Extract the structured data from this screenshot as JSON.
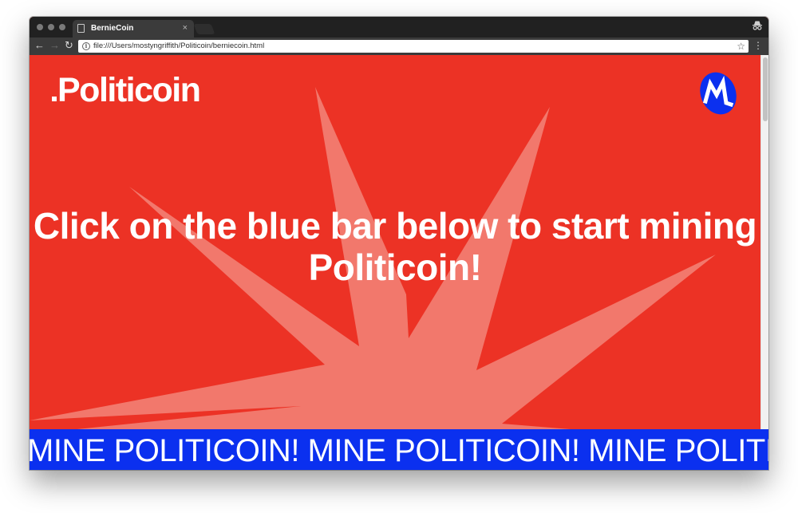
{
  "browser": {
    "tab_title": "BernieCoin",
    "tab_close": "×",
    "url": "file:///Users/mostyngriffith/Politicoin/berniecoin.html",
    "icons": {
      "back": "arrow-left",
      "forward": "arrow-right",
      "reload": "reload",
      "info": "info-circle",
      "bookmark": "star",
      "menu": "vertical-dots",
      "incognito": "incognito"
    }
  },
  "page": {
    "logo_text": "Politicoin",
    "headline": "Click on the blue bar below to start mining Politicoin!",
    "mine_bar_text": "MINE POLITICOIN! MINE POLITICOIN! MINE POLITICOIN!",
    "colors": {
      "background": "#ec3225",
      "burst": "#f2786c",
      "mine_bar": "#0b30ef",
      "badge": "#0b30ef"
    }
  }
}
